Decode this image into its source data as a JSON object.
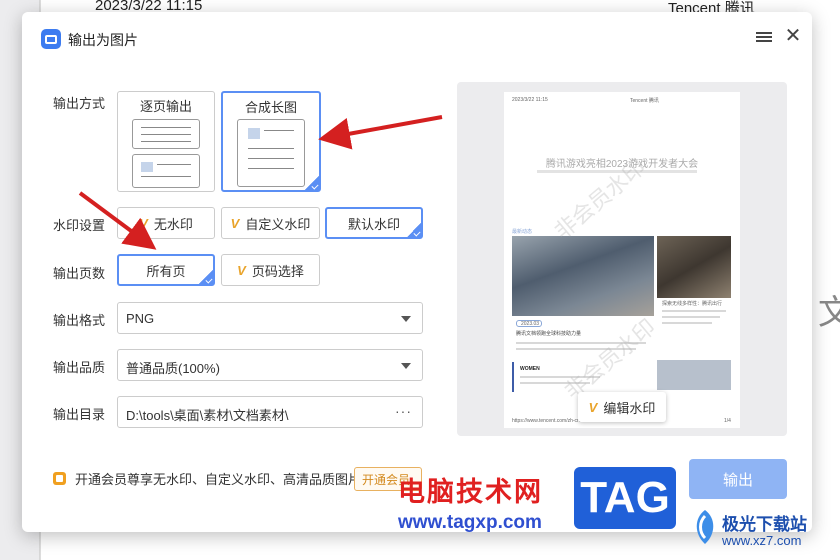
{
  "background": {
    "date": "2023/3/22 11:15",
    "brand": "Tencent 腾讯",
    "deco": "文"
  },
  "dialog": {
    "title": "输出为图片",
    "labels": {
      "mode": "输出方式",
      "watermark": "水印设置",
      "pages": "输出页数",
      "format": "输出格式",
      "quality": "输出品质",
      "directory": "输出目录"
    },
    "mode_options": [
      {
        "label": "逐页输出",
        "selected": false
      },
      {
        "label": "合成长图",
        "selected": true
      }
    ],
    "watermark_options": [
      {
        "label": "无水印",
        "icon": "v-icon",
        "selected": false
      },
      {
        "label": "自定义水印",
        "icon": "v-icon",
        "selected": false
      },
      {
        "label": "默认水印",
        "selected": true
      }
    ],
    "page_options": [
      {
        "label": "所有页",
        "selected": true
      },
      {
        "label": "页码选择",
        "icon": "v-icon",
        "selected": false
      }
    ],
    "format": {
      "value": "PNG"
    },
    "quality": {
      "value": "普通品质(100%)"
    },
    "directory": {
      "value": "D:\\tools\\桌面\\素材\\文档素材\\",
      "more": "···"
    },
    "preview": {
      "header_date": "2023/3/22 11:15",
      "header_brand": "Tencent 腾讯",
      "doc_title": "腾讯游戏亮相2023游戏开发者大会",
      "section": "最新动态",
      "tag": "2023.03",
      "news_title": "腾讯文档领跑全球科技助力量",
      "side_title": "探索无线多样性：腾讯出行",
      "watermark_text": "非会员水印",
      "footer_url": "https://www.tencent.com/zh-cn/",
      "footer_page": "1/4",
      "women_label": "WOMEN",
      "edit_watermark": "编辑水印"
    },
    "vip_text": "开通会员尊享无水印、自定义水印、高清品质图片",
    "vip_button": "开通会员",
    "export_button": "输出"
  },
  "overlay": {
    "site_name": "电脑技术网",
    "site_url": "www.tagxp.com",
    "tag_logo": "TAG",
    "download_name": "极光下载站",
    "download_url": "www.xz7.com"
  },
  "colors": {
    "accent": "#5b8ff4",
    "export_button": "#8fb4f4",
    "vip": "#f0a020",
    "arrow": "#d42020"
  }
}
